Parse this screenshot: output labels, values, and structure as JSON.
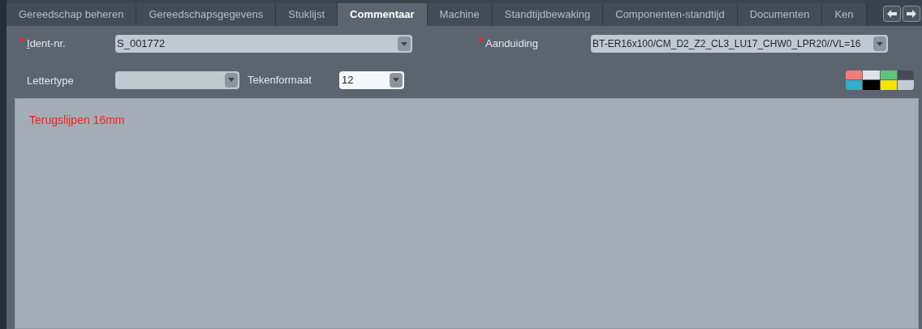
{
  "tabs": [
    {
      "label": "Gereedschap beheren",
      "selected": false
    },
    {
      "label": "Gereedschapsgegevens",
      "selected": false
    },
    {
      "label": "Stuklijst",
      "selected": false
    },
    {
      "label": "Commentaar",
      "selected": true
    },
    {
      "label": "Machine",
      "selected": false
    },
    {
      "label": "Standtijdbewaking",
      "selected": false
    },
    {
      "label": "Componenten-standtijd",
      "selected": false
    },
    {
      "label": "Documenten",
      "selected": false
    },
    {
      "label": "Ken",
      "selected": false
    }
  ],
  "ident": {
    "label": "Ident-nr.",
    "required": true,
    "underline_first": true,
    "value": "S_001772"
  },
  "aanduiding": {
    "label": "Aanduiding",
    "required": true,
    "underline_first": false,
    "value": "BT-ER16x100/CM_D2_Z2_CL3_LU17_CHW0_LPR20//VL=16"
  },
  "lettertype": {
    "label": "Lettertype"
  },
  "tekenformaat": {
    "label": "Tekenformaat",
    "value": "12"
  },
  "palette": [
    {
      "color": "#f47c7a"
    },
    {
      "color": "#dde3ea"
    },
    {
      "color": "#5fc47c"
    },
    {
      "color": "#434c55"
    },
    {
      "color": "#33adc8"
    },
    {
      "color": "#000000"
    },
    {
      "color": "#f2e600"
    },
    {
      "color": "#c2cad3"
    }
  ],
  "editor": {
    "text": "Terugslijpen 16mm",
    "color": "#ff1a1a"
  }
}
